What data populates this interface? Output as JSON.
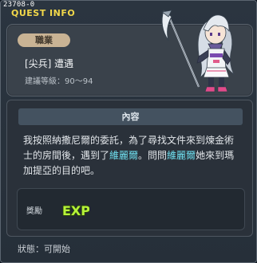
{
  "header": {
    "quest_id": "23708-0",
    "title": "QUEST INFO"
  },
  "job": {
    "badge": "職業",
    "name": "[尖兵] 遭遇",
    "level": "建議等級：90～94"
  },
  "content": {
    "heading": "內容",
    "text_parts": [
      "我按照納撒尼爾的委託，為了尋找文件來到煉金術士的房間後，遇到了",
      "維麗爾",
      "。問問",
      "維麗爾",
      "她來到瑪加提亞的目的吧。"
    ]
  },
  "reward": {
    "label": "獎勵",
    "icon": "exp-icon",
    "exp_text": "EXP"
  },
  "status": "狀態：可開始",
  "colors": {
    "title_yellow": "#f2d84a",
    "highlight": "#6fe0f0",
    "badge_bg": "#c9b394",
    "exp_green": "#b6f23a"
  }
}
